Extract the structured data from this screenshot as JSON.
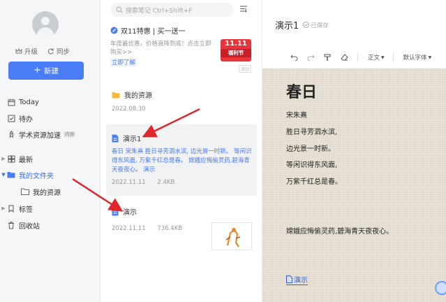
{
  "sidebar": {
    "upgrade_label": "升级",
    "sync_label": "同步",
    "new_button_label": "新建",
    "nav": [
      {
        "label": "Today"
      },
      {
        "label": "待办"
      },
      {
        "label": "学术资源加速",
        "badge": "内测"
      },
      {
        "label": "最新"
      },
      {
        "label": "我的文件夹"
      },
      {
        "label": "我的资源"
      },
      {
        "label": "标签"
      },
      {
        "label": "回收站"
      }
    ]
  },
  "list": {
    "search_placeholder": "搜索笔记 Ctrl+Shift+F",
    "promo": {
      "title": "双11特惠 | 买一送一",
      "desc": "年度最优惠，价格直降到底！点击立即购买>>",
      "link": "立即了解",
      "tag_top": "11.11",
      "tag_bottom": "福利节",
      "ad": "活动"
    },
    "items": [
      {
        "title": "我的资源",
        "date": "2022.08.30"
      },
      {
        "title": "演示1",
        "excerpt": "春日 宋朱熹 胜日寻芳泗水滨, 边光景一时新。 等闲识得东风面, 万紫千红总是春。 嫦娥应悔偷灵药,碧海青天夜夜心。 演示",
        "date": "2022.11.11",
        "size": "2.4KB"
      },
      {
        "title": "演示",
        "date": "2022.11.11",
        "size": "736.4KB"
      }
    ]
  },
  "editor": {
    "title": "演示1",
    "saved": "已保存",
    "style_dropdown": "正文",
    "font_dropdown": "默认字体",
    "poem_title": "春日",
    "lines": [
      "宋朱熹",
      "胜日寻芳泗水滨,",
      "边光景一时新。",
      "等闲识得东风面,",
      "万紫千红总是春。"
    ],
    "extra_line": "嫦娥应悔偷灵药,碧海青天夜夜心。",
    "attachment": "演示"
  },
  "colors": {
    "accent": "#4a7cf6",
    "arrow": "#e0252b",
    "promo_tag": "#e8353b"
  }
}
